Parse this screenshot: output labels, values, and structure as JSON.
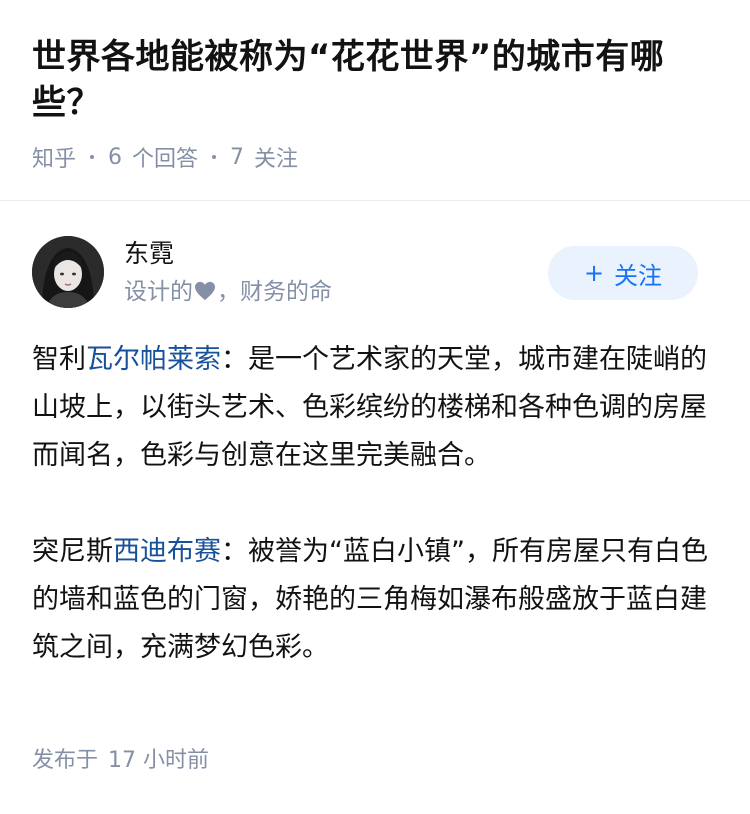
{
  "question": {
    "title": "世界各地能被称为“花花世界”的城市有哪些？",
    "source": "知乎",
    "answer_count": "6",
    "answer_label": "个回答",
    "follow_count": "7",
    "follow_label": "关注"
  },
  "author": {
    "name": "东霓",
    "bio_prefix": "设计的",
    "bio_suffix": "，财务的命",
    "follow_button": "关注",
    "follow_icon": "plus-icon"
  },
  "answer": {
    "paragraphs": [
      {
        "prefix": "智利",
        "link": "瓦尔帕莱索",
        "text": "：是一个艺术家的天堂，城市建在陡峭的山坡上，以街头艺术、色彩缤纷的楼梯和各种色调的房屋而闻名，色彩与创意在这里完美融合。"
      },
      {
        "prefix": "突尼斯",
        "link": "西迪布赛",
        "text": "：被誉为“蓝白小镇”，所有房屋只有白色的墙和蓝色的门窗，娇艳的三角梅如瀑布般盛放于蓝白建筑之间，充满梦幻色彩。"
      }
    ],
    "link_color": "#175199"
  },
  "footer": {
    "published_label": "发布于",
    "published_time": "17 小时前"
  },
  "colors": {
    "accent": "#1772f6",
    "follow_bg": "#e9f2fd",
    "meta_gray": "#8590a6"
  }
}
